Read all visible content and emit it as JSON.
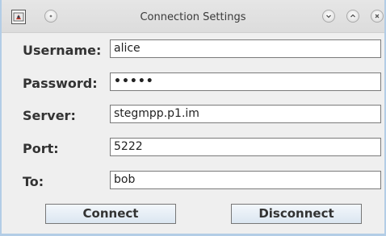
{
  "window": {
    "title": "Connection Settings"
  },
  "form": {
    "username": {
      "label": "Username:",
      "value": "alice"
    },
    "password": {
      "label": "Password:",
      "value": "•••••"
    },
    "server": {
      "label": "Server:",
      "value": "stegmpp.p1.im"
    },
    "port": {
      "label": "Port:",
      "value": "5222"
    },
    "to": {
      "label": "To:",
      "value": "bob"
    }
  },
  "buttons": {
    "connect": "Connect",
    "disconnect": "Disconnect"
  },
  "icons": {
    "app": "java-app-icon",
    "menu": "circle-menu-icon",
    "minimize": "chevron-down-icon",
    "maximize": "chevron-up-icon",
    "close": "close-icon"
  }
}
